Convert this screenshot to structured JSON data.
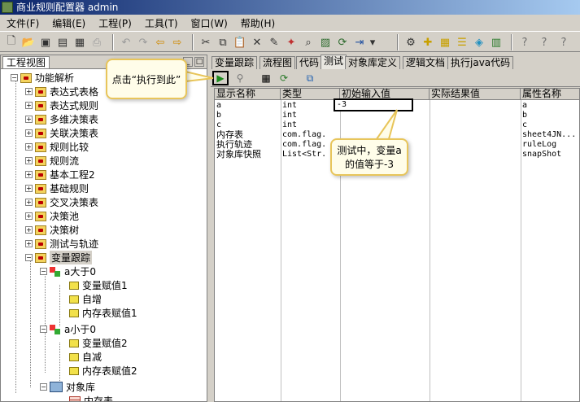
{
  "window": {
    "title": "商业规则配置器 admin"
  },
  "menu": [
    "文件(F)",
    "编辑(E)",
    "工程(P)",
    "工具(T)",
    "窗口(W)",
    "帮助(H)"
  ],
  "toolbar": {
    "icons": [
      "new-file-icon",
      "open-folder-icon",
      "save-icon",
      "save-all-icon",
      "disk-icon",
      "print-icon",
      "undo-icon",
      "redo-icon",
      "back-arrow-icon",
      "forward-arrow-icon",
      "cut-icon",
      "copy-icon",
      "paste-icon",
      "delete-icon",
      "edit-icon",
      "wand-icon",
      "find-icon",
      "image-icon",
      "refresh-icon",
      "indent-icon",
      "dropdown-icon",
      "settings-icon",
      "add-rule-icon",
      "add-table-icon",
      "add-list-icon",
      "component-icon",
      "chart-icon",
      "help-icon",
      "help-context-icon",
      "about-icon"
    ]
  },
  "left_pane": {
    "title": "工程视图",
    "tree": {
      "root": "功能解析",
      "folders": [
        "表达式表格",
        "表达式规则",
        "多维决策表",
        "关联决策表",
        "规则比较",
        "规则流",
        "基本工程2",
        "基础规则",
        "交叉决策表",
        "决策池",
        "决策树",
        "测试与轨迹"
      ],
      "selected_folder": "变量跟踪",
      "group1": {
        "label": "a大于0",
        "children": [
          "变量赋值1",
          "自增",
          "内存表赋值1"
        ]
      },
      "group2": {
        "label": "a小于0",
        "children": [
          "变量赋值2",
          "自减",
          "内存表赋值2"
        ]
      },
      "objlib": {
        "label": "对象库",
        "children": [
          "内存表"
        ]
      }
    }
  },
  "right_pane": {
    "tabs": [
      "变量跟踪",
      "流程图",
      "代码",
      "测试",
      "对象库定义",
      "逻辑文档",
      "执行java代码"
    ],
    "active_tab": "测试",
    "grid": {
      "columns": [
        "显示名称",
        "类型",
        "初始输入值",
        "实际结果值",
        "属性名称"
      ],
      "rows": [
        [
          "a",
          "int",
          "-3",
          "",
          "a"
        ],
        [
          "b",
          "int",
          "",
          "",
          "b"
        ],
        [
          "c",
          "int",
          "",
          "",
          "c"
        ],
        [
          "内存表",
          "com.flag.",
          "",
          "",
          "sheet4JN..."
        ],
        [
          "执行轨迹",
          "com.flag.",
          "",
          "",
          "ruleLog"
        ],
        [
          "对象库快照",
          "List<Str.",
          "",
          "",
          "snapShot"
        ]
      ]
    }
  },
  "callouts": {
    "run": "点击“执行到此”",
    "value": "测试中，变量a的值等于-3"
  }
}
